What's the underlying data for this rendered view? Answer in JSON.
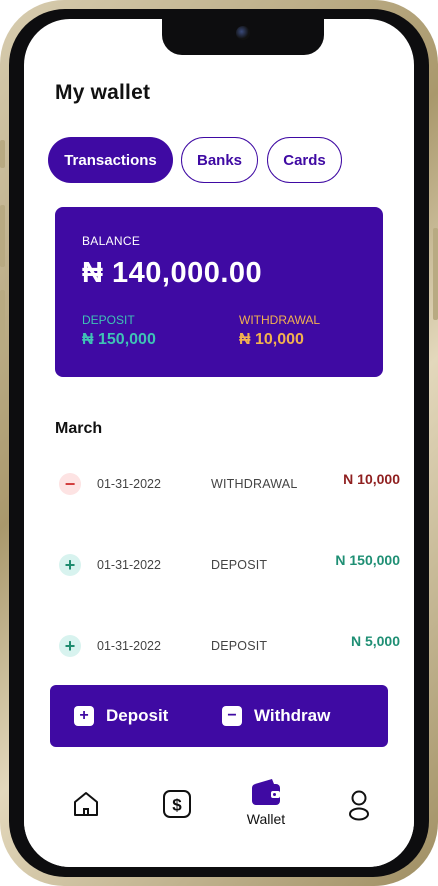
{
  "header": {
    "title": "My wallet"
  },
  "tabs": [
    {
      "label": "Transactions",
      "active": true
    },
    {
      "label": "Banks",
      "active": false
    },
    {
      "label": "Cards",
      "active": false
    }
  ],
  "balance_card": {
    "balance_label": "BALANCE",
    "balance_amount": "₦ 140,000.00",
    "deposit_label": "DEPOSIT",
    "deposit_amount": "₦ 150,000",
    "withdrawal_label": "WITHDRAWAL",
    "withdrawal_amount": "₦ 10,000"
  },
  "transactions": {
    "month": "March",
    "rows": [
      {
        "date": "01-31-2022",
        "type": "WITHDRAWAL",
        "amount": "N 10,000",
        "direction": "minus-icon"
      },
      {
        "date": "01-31-2022",
        "type": "DEPOSIT",
        "amount": "N 150,000",
        "direction": "plus-icon"
      },
      {
        "date": "01-31-2022",
        "type": "DEPOSIT",
        "amount": "N 5,000",
        "direction": "plus-icon"
      }
    ]
  },
  "actions": {
    "deposit_label": "Deposit",
    "withdraw_label": "Withdraw"
  },
  "bottom_nav": {
    "items": [
      {
        "icon": "home-icon",
        "label": ""
      },
      {
        "icon": "dollar-icon",
        "label": ""
      },
      {
        "icon": "wallet-icon",
        "label": "Wallet",
        "active": true
      },
      {
        "icon": "profile-icon",
        "label": ""
      }
    ]
  },
  "colors": {
    "primary": "#3f0aa3",
    "deposit": "#3fc2b5",
    "withdrawal": "#f2b14f",
    "negative_amount": "#8f1f1f",
    "positive_amount": "#1f8f74"
  }
}
